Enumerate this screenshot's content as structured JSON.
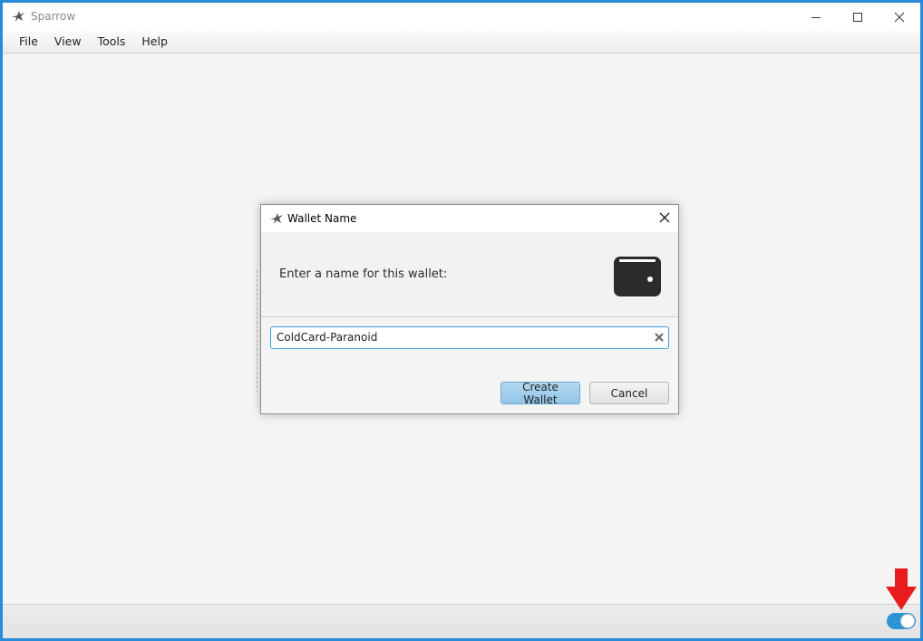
{
  "window": {
    "title": "Sparrow",
    "icons": {
      "app": "sparrow-logo-icon",
      "minimize": "minimize-icon",
      "maximize": "maximize-icon",
      "close": "close-icon"
    }
  },
  "menubar": {
    "items": [
      {
        "label": "File"
      },
      {
        "label": "View"
      },
      {
        "label": "Tools"
      },
      {
        "label": "Help"
      }
    ]
  },
  "dialog": {
    "title": "Wallet Name",
    "prompt": "Enter a name for this wallet:",
    "wallet_name": {
      "value": "ColdCard-Paranoid",
      "placeholder": ""
    },
    "create_label": "Create Wallet",
    "cancel_label": "Cancel"
  },
  "statusbar": {
    "online_toggle_on": true
  },
  "colors": {
    "accent": "#2c93d5",
    "primary_button": "#a3cfec",
    "annotation_arrow": "#e81c1c",
    "window_border": "#2a8ad8"
  }
}
